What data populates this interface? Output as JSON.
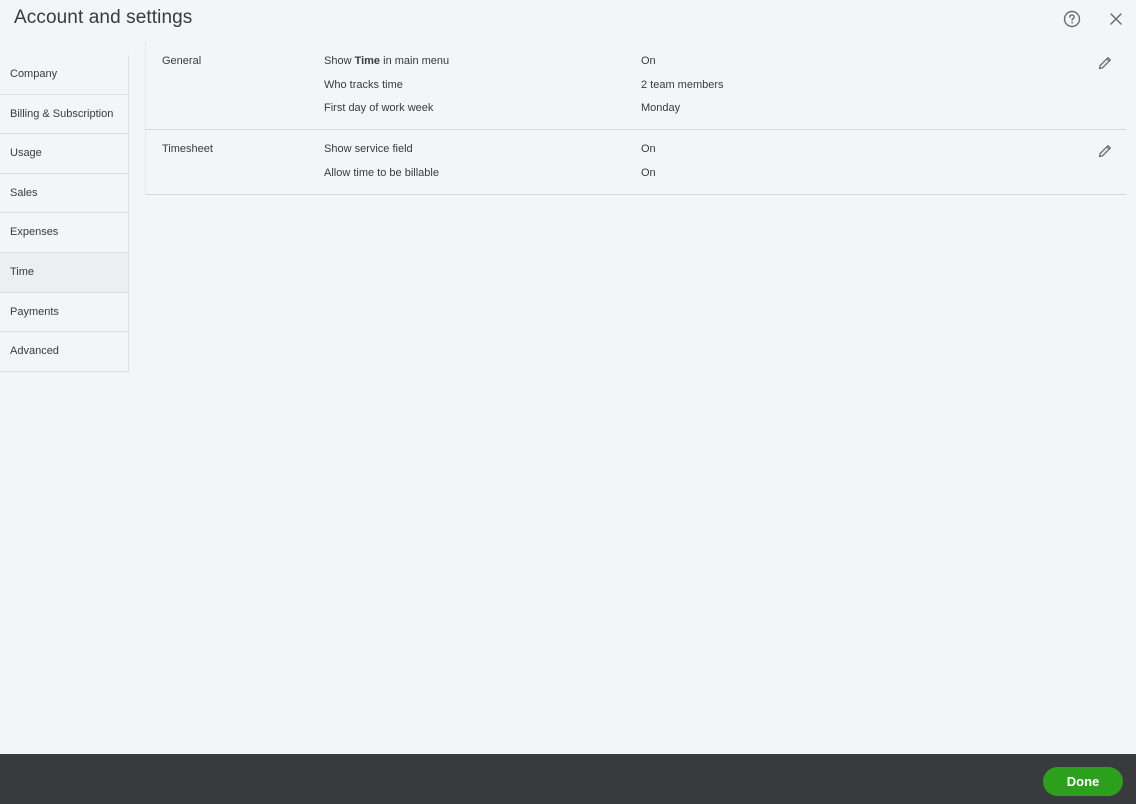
{
  "header": {
    "title": "Account and settings"
  },
  "sidebar": {
    "items": [
      {
        "label": "Company"
      },
      {
        "label": "Billing & Subscription"
      },
      {
        "label": "Usage"
      },
      {
        "label": "Sales"
      },
      {
        "label": "Expenses"
      },
      {
        "label": "Time"
      },
      {
        "label": "Payments"
      },
      {
        "label": "Advanced"
      }
    ]
  },
  "sections": {
    "general": {
      "title": "General",
      "rows": [
        {
          "label_pre": "Show ",
          "label_bold": "Time",
          "label_post": " in main menu",
          "value": "On"
        },
        {
          "label": "Who tracks time",
          "value": "2 team members"
        },
        {
          "label": "First day of work week",
          "value": "Monday"
        }
      ]
    },
    "timesheet": {
      "title": "Timesheet",
      "rows": [
        {
          "label": "Show service field",
          "value": "On"
        },
        {
          "label": "Allow time to be billable",
          "value": "On"
        }
      ]
    }
  },
  "footer": {
    "done_label": "Done",
    "done_color": "#2ca01c"
  },
  "icons": {
    "help": "help-circle-icon",
    "close": "close-icon",
    "edit": "pencil-icon"
  }
}
